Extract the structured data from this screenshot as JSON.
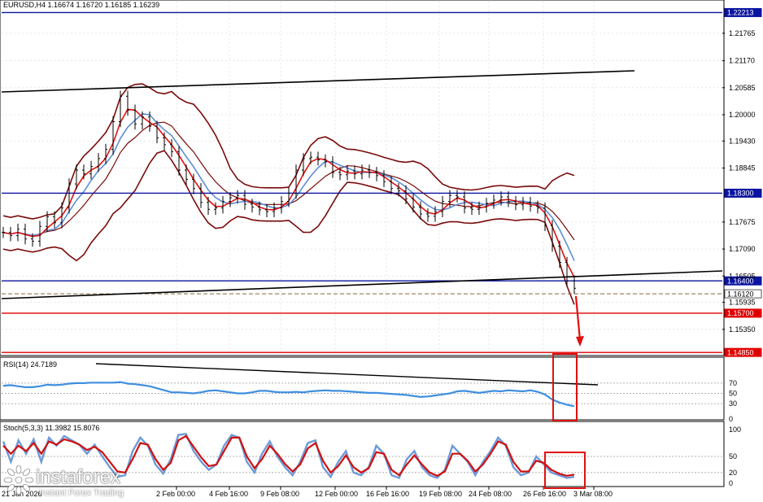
{
  "header": {
    "symbol_line": "EURUSD,H4  1.16674 1.16720 1.16185 1.16239"
  },
  "indicators": {
    "rsi_label": "RSI(14) 24.7189",
    "stoch_label": "Stoch(5,3,3) 11.3982 15.8076"
  },
  "logo": {
    "name": "instaforex",
    "tagline": "Instant Forex Trading"
  },
  "colors": {
    "horizontal_level": "#0a14a0",
    "target_level": "#e00000",
    "price_line": "#000000",
    "bollinger": "#7a0a0a",
    "ma_red": "#e01010",
    "ma_blue": "#5b8fd6",
    "rsi_line": "#3f8fe0",
    "stoch_main": "#6d9ad8",
    "stoch_signal": "#d01010",
    "arrow": "#e01010"
  },
  "chart_data": [
    {
      "type": "line",
      "title": "EURUSD,H4",
      "ohlc_last": {
        "open": 1.16674,
        "high": 1.1672,
        "low": 1.16185,
        "close": 1.16239
      },
      "y_ticks": [
        "1.22213",
        "1.21765",
        "1.21170",
        "1.20585",
        "1.20000",
        "1.19430",
        "1.18845",
        "1.18300",
        "1.17675",
        "1.17090",
        "1.16505",
        "1.16400",
        "1.16120",
        "1.15935",
        "1.15700",
        "1.15350",
        "1.14850"
      ],
      "ylim": [
        1.148,
        1.2245
      ],
      "x_ticks": [
        "2 Feb 00:00",
        "4 Feb 16:00",
        "9 Feb 08:00",
        "12 Feb 00:00",
        "16 Feb 16:00",
        "19 Feb 08:00",
        "24 Feb 08:00",
        "26 Feb 16:00",
        "3 Mar 08:00"
      ],
      "partial_x_tick": "21 Jan 2026",
      "levels": [
        {
          "value": 1.22213,
          "label": "1.22213",
          "kind": "resistance"
        },
        {
          "value": 1.183,
          "label": "1.18300",
          "kind": "resistance"
        },
        {
          "value": 1.164,
          "label": "1.16400",
          "kind": "support"
        },
        {
          "value": 1.1612,
          "label": "1.16120",
          "kind": "current"
        },
        {
          "value": 1.157,
          "label": "1.15700",
          "kind": "target"
        },
        {
          "value": 1.1485,
          "label": "1.14850",
          "kind": "target"
        }
      ],
      "series": [
        {
          "kind": "price",
          "values": [
            1.1745,
            1.1738,
            1.1752,
            1.1731,
            1.1726,
            1.1758,
            1.1779,
            1.1766,
            1.1798,
            1.185,
            1.188,
            1.1872,
            1.1888,
            1.1905,
            1.1925,
            1.1985,
            1.204,
            1.201,
            1.198,
            1.1995,
            1.1975,
            1.195,
            1.1935,
            1.192,
            1.188,
            1.186,
            1.184,
            1.181,
            1.1795,
            1.1798,
            1.1812,
            1.182,
            1.1825,
            1.1806,
            1.18,
            1.1794,
            1.179,
            1.1798,
            1.1812,
            1.183,
            1.188,
            1.1905,
            1.1908,
            1.1902,
            1.1898,
            1.1875,
            1.187,
            1.1878,
            1.1872,
            1.188,
            1.1875,
            1.1868,
            1.1855,
            1.184,
            1.1835,
            1.1818,
            1.18,
            1.1785,
            1.178,
            1.179,
            1.1812,
            1.1825,
            1.1822,
            1.1798,
            1.1795,
            1.18,
            1.1808,
            1.1815,
            1.1822,
            1.1812,
            1.1805,
            1.181,
            1.1802,
            1.1798,
            1.176,
            1.1715,
            1.168,
            1.164,
            1.1624
          ]
        },
        {
          "kind": "rsi",
          "values": [
            65,
            66,
            64,
            62,
            62,
            64,
            67,
            66,
            67,
            69,
            70,
            70,
            71,
            71,
            71,
            71,
            72,
            69,
            68,
            66,
            64,
            60,
            56,
            52,
            52,
            51,
            50,
            52,
            55,
            56,
            54,
            52,
            50,
            50,
            52,
            55,
            55,
            53,
            52,
            52,
            53,
            52,
            54,
            55,
            56,
            55,
            55,
            54,
            53,
            52,
            51,
            51,
            50,
            49,
            48,
            47,
            45,
            43,
            44,
            46,
            48,
            50,
            54,
            55,
            53,
            51,
            53,
            55,
            54,
            56,
            55,
            54,
            56,
            53,
            48,
            38,
            32,
            28,
            25
          ]
        },
        {
          "kind": "stoch_main",
          "values": [
            78,
            40,
            80,
            55,
            82,
            40,
            85,
            70,
            88,
            80,
            72,
            55,
            72,
            50,
            30,
            12,
            15,
            60,
            85,
            70,
            35,
            18,
            45,
            90,
            92,
            60,
            40,
            25,
            35,
            70,
            90,
            85,
            40,
            20,
            55,
            78,
            50,
            30,
            15,
            40,
            75,
            80,
            30,
            12,
            40,
            60,
            20,
            15,
            30,
            70,
            55,
            15,
            10,
            45,
            60,
            30,
            15,
            10,
            25,
            70,
            55,
            40,
            15,
            40,
            60,
            85,
            70,
            30,
            15,
            20,
            50,
            35,
            20,
            15,
            10,
            12
          ]
        },
        {
          "kind": "stoch_signal",
          "values": [
            70,
            55,
            70,
            60,
            75,
            55,
            78,
            72,
            82,
            78,
            72,
            62,
            68,
            58,
            40,
            22,
            20,
            45,
            75,
            72,
            45,
            25,
            38,
            80,
            88,
            68,
            48,
            32,
            35,
            60,
            85,
            85,
            50,
            28,
            45,
            70,
            55,
            36,
            22,
            35,
            65,
            75,
            42,
            20,
            32,
            52,
            30,
            20,
            28,
            58,
            55,
            25,
            15,
            35,
            52,
            35,
            20,
            14,
            22,
            55,
            55,
            42,
            22,
            35,
            55,
            78,
            72,
            40,
            22,
            22,
            42,
            38,
            25,
            18,
            14,
            16
          ]
        }
      ],
      "rsi_levels": [
        "70",
        "50",
        "30"
      ],
      "rsi_ticks": [
        "70",
        "50",
        "30",
        "0"
      ],
      "stoch_ticks": [
        "100",
        "50",
        "20",
        "0"
      ]
    }
  ]
}
